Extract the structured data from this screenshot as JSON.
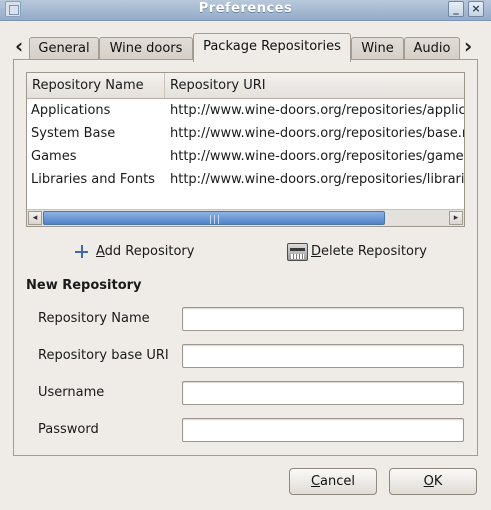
{
  "window": {
    "title": "Preferences",
    "minimize_glyph": "_",
    "close_glyph": "×"
  },
  "tabs": [
    {
      "label": "General"
    },
    {
      "label": "Wine doors"
    },
    {
      "label": "Package Repositories"
    },
    {
      "label": "Wine"
    },
    {
      "label": "Audio"
    }
  ],
  "active_tab": "Package Repositories",
  "tab_scroll": {
    "left_glyph": "‹",
    "right_glyph": "›"
  },
  "repositories": {
    "columns": [
      "Repository Name",
      "Repository URI"
    ],
    "rows": [
      {
        "name": "Applications",
        "uri": "http://www.wine-doors.org/repositories/applic"
      },
      {
        "name": "System Base",
        "uri": "http://www.wine-doors.org/repositories/base.r"
      },
      {
        "name": "Games",
        "uri": "http://www.wine-doors.org/repositories/game"
      },
      {
        "name": "Libraries and Fonts",
        "uri": "http://www.wine-doors.org/repositories/librari"
      }
    ]
  },
  "actions": {
    "add_mnemonic": "A",
    "add_rest": "dd Repository",
    "delete_mnemonic": "D",
    "delete_rest": "elete Repository"
  },
  "new_repository": {
    "section_title": "New Repository",
    "name_label": "Repository Name",
    "name_value": "",
    "uri_label": "Repository base URI",
    "uri_value": "",
    "username_label": "Username",
    "username_value": "",
    "password_label": "Password",
    "password_value": ""
  },
  "dialog_buttons": {
    "cancel_mnemonic": "C",
    "cancel_rest": "ancel",
    "ok_mnemonic": "O",
    "ok_rest": "K"
  },
  "colors": {
    "titlebar": "#93abc8",
    "scroll_thumb": "#4f83c7",
    "background": "#efebe7"
  },
  "icons": {
    "add": "plus-icon",
    "delete": "shredder-icon",
    "window": "window-icon"
  }
}
